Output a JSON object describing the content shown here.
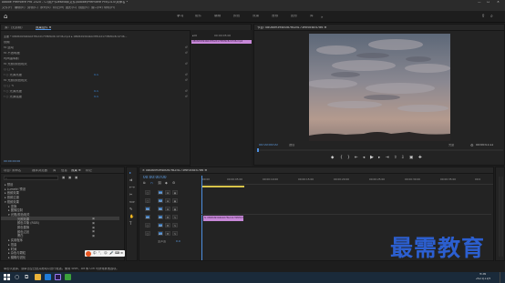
{
  "app": {
    "title": "Adobe Premiere Pro 2020 - C:\\用户\\Desktop\\文件\\Adobe\\Premiere Pro\\14.0\\未命名 *",
    "window_controls": [
      "—",
      "☐",
      "✕"
    ]
  },
  "menu": [
    "文件(F)",
    "编辑(E)",
    "剪辑(C)",
    "序列(S)",
    "标记(M)",
    "图形(G)",
    "视图(V)",
    "窗口(W)",
    "帮助(H)"
  ],
  "workspace_tabs": [
    {
      "label": "学习",
      "active": true
    },
    {
      "label": "组件",
      "active": false
    },
    {
      "label": "编辑",
      "active": false
    },
    {
      "label": "颜色",
      "active": false
    },
    {
      "label": "效果",
      "active": false
    },
    {
      "label": "音频",
      "active": false
    },
    {
      "label": "图形",
      "active": false
    },
    {
      "label": "库",
      "active": false
    }
  ],
  "effect_controls": {
    "tabs": [
      "源：(无剪辑)",
      "效果控件 ≡"
    ],
    "clip_path": "主要 * 0808d9394b0d7fb2d173f6f0c8c47d6.mp4 ▸ 0808d9394b0d7fb2d173f6f0c8c47d6...",
    "clip_badge": "0808d9394b0d7fb2d173f6f0c8c47d6.mp4",
    "mini_time": "00:00:05:00",
    "rows": [
      {
        "label": "视频",
        "value": ""
      },
      {
        "label": "fx  运动",
        "value": ""
      },
      {
        "label": "fx  不透明度",
        "value": ""
      },
      {
        "label": "   时间重映射",
        "value": ""
      },
      {
        "label": "fx  光照/颜色相关",
        "value": ""
      },
      {
        "label": "   ○ □ ✎",
        "value": ""
      },
      {
        "label": "   › ○ 光源亮度",
        "value": "0.0"
      },
      {
        "label": "fx  光照/颜色相关",
        "value": ""
      },
      {
        "label": "   ○ □ ✎",
        "value": ""
      },
      {
        "label": "   › ○ 光源亮度",
        "value": "0.0"
      },
      {
        "label": "   › ○ 光源强度",
        "value": "0.0"
      }
    ],
    "bottom_time": "00:00:00:00"
  },
  "program": {
    "tab": "节目: 0808d9394b0d7fb2d173f6f0c8c47d6 ≡",
    "timecode": "00:00:00:00",
    "fit": "适合",
    "quality": "完整",
    "duration": "00:00:01:22"
  },
  "project": {
    "tabs": [
      "项目: 未命名",
      "媒体浏览器",
      "库",
      "信息",
      "效果 ≡",
      "标记"
    ],
    "tree": [
      {
        "label": "▸ 预设",
        "indent": 0,
        "selected": false
      },
      {
        "label": "▸ Lumetri 预设",
        "indent": 0,
        "selected": false
      },
      {
        "label": "▸ 音频效果",
        "indent": 0,
        "selected": false
      },
      {
        "label": "▸ 音频过渡",
        "indent": 0,
        "selected": false
      },
      {
        "label": "▾ 视频效果",
        "indent": 0,
        "selected": false
      },
      {
        "label": "▸ 变换",
        "indent": 1,
        "selected": false
      },
      {
        "label": "▸ 图像控制",
        "indent": 1,
        "selected": false
      },
      {
        "label": "▾ 光照/颜色相关",
        "indent": 1,
        "selected": false
      },
      {
        "label": "光照效果",
        "indent": 2,
        "selected": true
      },
      {
        "label": "颜色平衡 (RGB)",
        "indent": 2,
        "selected": false
      },
      {
        "label": "颜色替换",
        "indent": 2,
        "selected": false
      },
      {
        "label": "颜色过滤",
        "indent": 2,
        "selected": false
      },
      {
        "label": "黑白",
        "indent": 2,
        "selected": false
      },
      {
        "label": "▸ 实用程序",
        "indent": 1,
        "selected": false
      },
      {
        "label": "▸ 扭曲",
        "indent": 1,
        "selected": false
      },
      {
        "label": "▸ 时间",
        "indent": 1,
        "selected": false
      },
      {
        "label": "▸ 杂色与颗粒",
        "indent": 1,
        "selected": false
      },
      {
        "label": "▸ 模糊与锐化",
        "indent": 1,
        "selected": false
      }
    ]
  },
  "timeline": {
    "tab": "× 0808d9394b0d7fb2d173f6f0c8c47d6 ≡",
    "timecode": "00:00:00:00",
    "ruler_labels": [
      ":00:00",
      "00:00:05:00",
      "00:00:10:00",
      "00:00:15:00",
      "00:00:20:00",
      "00:00:25:00",
      "00:00:30:00",
      "00:00:35:00",
      "00:0"
    ],
    "tracks": [
      {
        "id": "V3",
        "buttons": [
          "V3",
          "⊕",
          "◉"
        ]
      },
      {
        "id": "V2",
        "buttons": [
          "V2",
          "⊕",
          "◉"
        ]
      },
      {
        "id": "V1",
        "buttons": [
          "V1",
          "⊕",
          "◉"
        ]
      },
      {
        "id": "A1",
        "buttons": [
          "A1",
          "M",
          "S"
        ]
      },
      {
        "id": "A2",
        "buttons": [
          "A2",
          "M",
          "S"
        ]
      },
      {
        "id": "A3",
        "buttons": [
          "A3",
          "M",
          "S"
        ]
      },
      {
        "id": "主声道",
        "buttons": [
          "主声道",
          "0.0",
          ""
        ]
      }
    ],
    "clip_label": "fx 0808d9394b0d7fb2d173f6f0c8c47d6.mp4"
  },
  "status_text": "单击以选择，或单击空白处并拖动以进行框选。使用 Shift、Alt 和 Ctrl 可获得其他选项。",
  "watermark": "最需教育",
  "taskbar": {
    "time": "9:36",
    "date": "2021/11/9"
  },
  "colors": {
    "accent_blue": "#2f7ed8",
    "clip_pink": "#c788d8",
    "playhead": "#4d8fe0"
  }
}
